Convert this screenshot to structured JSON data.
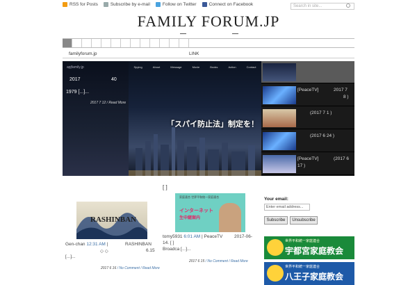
{
  "header": {
    "links": [
      {
        "label": "RSS for Posts",
        "icon": "rss-icon"
      },
      {
        "label": "Subscribe by e-mail",
        "icon": "mail-icon"
      },
      {
        "label": "Follow on Twitter",
        "icon": "twitter-icon"
      },
      {
        "label": "Connect on Facebook",
        "icon": "facebook-icon"
      }
    ],
    "search_placeholder": "Search in site...",
    "site_title": "FAMILY FORUM.JP"
  },
  "subnav": {
    "home": "familyforum.jp",
    "link": "LINK"
  },
  "slider": {
    "brand": "apjfamily.jp",
    "menu": [
      "Spying",
      "About",
      "Message",
      "Movie",
      "Books",
      "Action",
      "Contact"
    ],
    "date": "2017",
    "num": "40",
    "desc": "1979 [...]...",
    "meta_date": "2017 7 12",
    "read_more": "/ Read More",
    "banner": "「スパイ防止法」制定を！"
  },
  "thumbs": [
    {
      "title": "",
      "date": ""
    },
    {
      "title": "[PeaceTV]",
      "date": "2017 7",
      "date2": "8 )"
    },
    {
      "title": "",
      "date": "(2017 7 1 )"
    },
    {
      "title": "",
      "date": "(2017 6 24 )"
    },
    {
      "title": "[PeaceTV]",
      "date": "(2017 6",
      "date2": "17 )"
    }
  ],
  "posts_head": "[ ]",
  "post1": {
    "image_label": "RASHINBAN",
    "author": "Gen-chan",
    "time": "12:31 AM",
    "sep": "|",
    "title": "RASHINBAN",
    "diamonds": "◇ ◇",
    "date_right": "6.15",
    "excerpt": "[...]...",
    "meta_date": "2017 6 16",
    "comments": "/ No Comment",
    "read_more": "/ Read More"
  },
  "post2": {
    "img_top": "家庭連合 世界平和統一家庭連合",
    "img_main": "インターネット",
    "img_sub": "生中継案内",
    "author": "tomy5931",
    "time": "6:01 AM",
    "sep": "|",
    "title": "PeaceTV",
    "date_right": "2017-06-",
    "line2": "14. [ ]",
    "line3": "Broadca [...]...",
    "meta_date": "2017 6 15",
    "comments": "/ No Comment",
    "read_more": "/ Read More"
  },
  "sidebar": {
    "email_label": "Your email:",
    "email_placeholder": "Enter email address...",
    "subscribe": "Subscribe",
    "unsubscribe": "Unsubscribe",
    "ad1_small": "世界平和統一家庭連合",
    "ad1_main": "宇都宮家庭教会",
    "ad2_small": "世界平和統一家庭連合",
    "ad2_main": "八王子家庭教会"
  },
  "colors": {
    "link": "#3a6ea5",
    "ad1": "#1a8a3a",
    "ad2": "#1e5aa8"
  }
}
